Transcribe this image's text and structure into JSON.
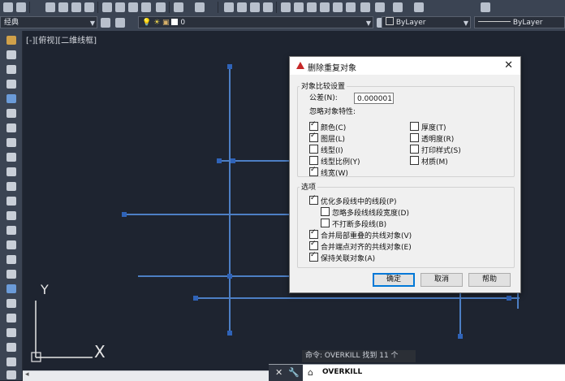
{
  "toolbar": {
    "workspace": "经典",
    "layer_value": "0",
    "color_value": "ByLayer",
    "linetype_value": "ByLayer"
  },
  "viewport": {
    "label": "[-][俯视][二维线框]"
  },
  "dialog": {
    "title": "删除重复对象",
    "compare_section": "对象比较设置",
    "tolerance_label": "公差(N):",
    "tolerance_value": "0.000001",
    "ignore_label": "忽略对象特性:",
    "props_left": [
      {
        "label": "颜色(C)",
        "checked": true
      },
      {
        "label": "图层(L)",
        "checked": true
      },
      {
        "label": "线型(I)",
        "checked": false
      },
      {
        "label": "线型比例(Y)",
        "checked": false
      },
      {
        "label": "线宽(W)",
        "checked": true
      }
    ],
    "props_right": [
      {
        "label": "厚度(T)",
        "checked": false
      },
      {
        "label": "透明度(R)",
        "checked": false
      },
      {
        "label": "打印样式(S)",
        "checked": false
      },
      {
        "label": "材质(M)",
        "checked": false
      }
    ],
    "options_section": "选项",
    "options": [
      {
        "label": "优化多段线中的线段(P)",
        "checked": true,
        "indent": 0
      },
      {
        "label": "忽略多段线线段宽度(D)",
        "checked": false,
        "indent": 1
      },
      {
        "label": "不打断多段线(B)",
        "checked": false,
        "indent": 1
      },
      {
        "label": "合并局部重叠的共线对象(V)",
        "checked": true,
        "indent": 0
      },
      {
        "label": "合并端点对齐的共线对象(E)",
        "checked": true,
        "indent": 0
      },
      {
        "label": "保持关联对象(A)",
        "checked": true,
        "indent": 0
      }
    ],
    "ok_label": "确定",
    "cancel_label": "取消",
    "help_label": "帮助"
  },
  "status": {
    "command_history": "命令: OVERKILL 找到 11 个",
    "command_input": "OVERKILL"
  },
  "ucs": {
    "x_label": "X",
    "y_label": "Y"
  }
}
